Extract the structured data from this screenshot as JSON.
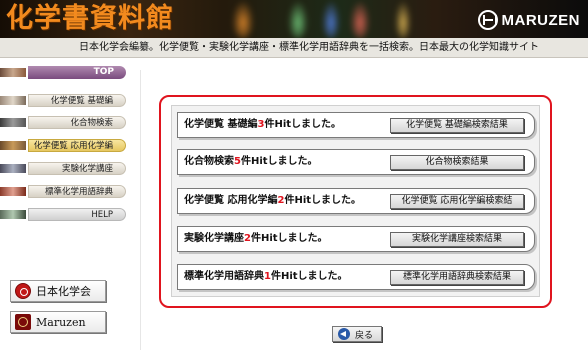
{
  "header": {
    "title": "化学書資料館",
    "publisher": "MARUZEN",
    "publisher_logo_icon": "maruzen-logo-icon"
  },
  "tagline": "日本化学会編纂。化学便覧・実験化学講座・標準化学用語辞典を一括検索。日本最大の化学知識サイト",
  "sidebar": {
    "items": [
      {
        "label": "TOP",
        "icon": "photo-thumbnail-icon"
      },
      {
        "label": "化学便覧 基礎編",
        "icon": "photo-thumbnail-icon"
      },
      {
        "label": "化合物検索",
        "icon": "photo-thumbnail-icon"
      },
      {
        "label": "化学便覧 応用化学編",
        "icon": "photo-thumbnail-icon"
      },
      {
        "label": "実験化学講座",
        "icon": "photo-thumbnail-icon"
      },
      {
        "label": "標準化学用語辞典",
        "icon": "photo-thumbnail-icon"
      },
      {
        "label": "HELP",
        "icon": "photo-thumbnail-icon"
      }
    ],
    "selected_index": 3
  },
  "side_buttons": {
    "csj": {
      "label": "日本化学会",
      "icon": "csj-seal-icon"
    },
    "maruzen": {
      "label": "Maruzen",
      "icon": "maruzen-mark-icon"
    }
  },
  "results": [
    {
      "prefix": "化学便覧 基礎編",
      "count": "3",
      "suffix": "件Hitしました。",
      "button": "化学便覧 基礎編検索結果"
    },
    {
      "prefix": "化合物検索",
      "count": "5",
      "suffix": "件Hitしました。",
      "button": "化合物検索結果"
    },
    {
      "prefix": "化学便覧 応用化学編",
      "count": "2",
      "suffix": "件Hitしました。",
      "button": "化学便覧 応用化学編検索結"
    },
    {
      "prefix": "実験化学講座",
      "count": "2",
      "suffix": "件Hitしました。",
      "button": "実験化学講座検索結果"
    },
    {
      "prefix": "標準化学用語辞典",
      "count": "1",
      "suffix": "件Hitしました。",
      "button": "標準化学用語辞典検索結果"
    }
  ],
  "back_button": {
    "label": "戻る",
    "icon": "back-arrow-icon"
  },
  "colors": {
    "title": "#f28a1e",
    "highlight_frame": "#e0141e",
    "count": "#e0141e",
    "nav_top": "#7a4b7e",
    "nav_selected": "#e6c760"
  }
}
